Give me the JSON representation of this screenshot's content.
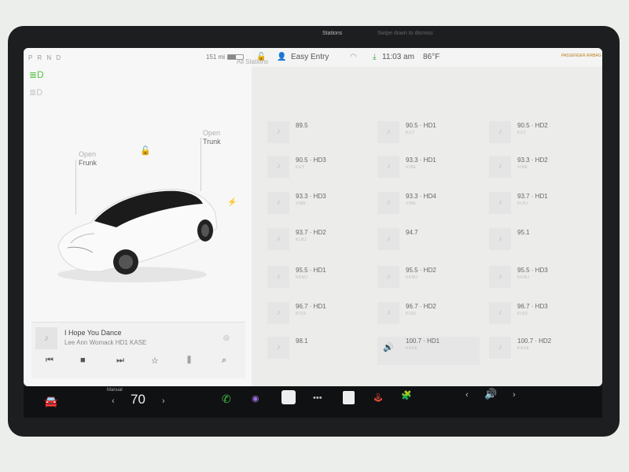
{
  "status": {
    "gear": "P R N D",
    "range": "151 mi",
    "profile": "Easy Entry",
    "time": "11:03 am",
    "temp": "86°F",
    "airbag": "PASSENGER AIRBAG"
  },
  "car": {
    "frunk_label": "Open",
    "frunk_sub": "Frunk",
    "trunk_label": "Open",
    "trunk_sub": "Trunk"
  },
  "media": {
    "song": "I Hope You Dance",
    "artist": "Lee Ann Womack",
    "source": "HD1 KASE"
  },
  "radio": {
    "tabs": [
      "Stations",
      "Swipe down to dismiss"
    ],
    "section": "All Stations",
    "stations": [
      {
        "freq": "89.5",
        "call": ""
      },
      {
        "freq": "90.5 · HD1",
        "call": "KUT"
      },
      {
        "freq": "90.5 · HD2",
        "call": "KUT"
      },
      {
        "freq": "90.5 · HD3",
        "call": "KUT"
      },
      {
        "freq": "93.3 · HD1",
        "call": "VIBE"
      },
      {
        "freq": "93.3 · HD2",
        "call": "VIBE"
      },
      {
        "freq": "93.3 · HD3",
        "call": "VIBE"
      },
      {
        "freq": "93.3 · HD4",
        "call": "VIBE"
      },
      {
        "freq": "93.7 · HD1",
        "call": "KLBJ"
      },
      {
        "freq": "93.7 · HD2",
        "call": "KLBJ"
      },
      {
        "freq": "94.7",
        "call": ""
      },
      {
        "freq": "95.1",
        "call": ""
      },
      {
        "freq": "95.5 · HD1",
        "call": "KKMJ"
      },
      {
        "freq": "95.5 · HD2",
        "call": "KKMJ"
      },
      {
        "freq": "95.5 · HD3",
        "call": "KKMJ"
      },
      {
        "freq": "96.7 · HD1",
        "call": "KISS"
      },
      {
        "freq": "96.7 · HD2",
        "call": "KISS"
      },
      {
        "freq": "96.7 · HD3",
        "call": "KISS"
      },
      {
        "freq": "98.1",
        "call": ""
      },
      {
        "freq": "100.7 · HD1",
        "call": "KASE"
      },
      {
        "freq": "100.7 · HD2",
        "call": "KASE"
      }
    ]
  },
  "dock": {
    "speed_label": "Manual",
    "speed": "70"
  }
}
